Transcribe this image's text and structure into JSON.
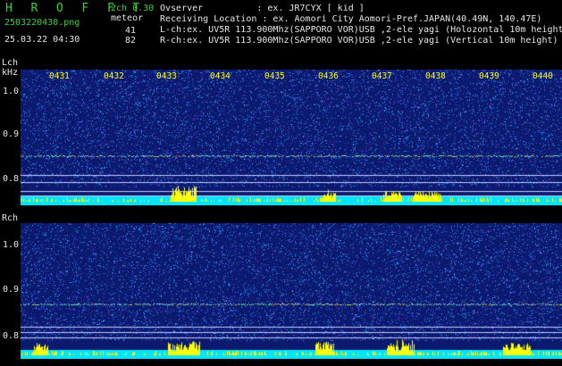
{
  "header": {
    "brand": "H R O F F T",
    "filename": "2503220430.png",
    "datetime": "25.03.22 04:30",
    "mode": "2ch 0.30",
    "meteor_label": "meteor",
    "meteor_lch": "41",
    "meteor_rch": "82",
    "info_lines": [
      "Ovserver          : ex. JR7CYX [ kid ]",
      "Receiving Location : ex. Aomori City Aomori-Pref.JAPAN(40.49N, 140.47E)",
      "L-ch:ex. UV5R 113.900Mhz(SAPPORO VOR)USB ,2-ele yagi (Holozontal 10m height",
      "R-ch:ex. UV5R 113.900Mhz(SAPPORO VOR)USB ,2-ele yagi (Vertical 10m height)"
    ]
  },
  "lch": {
    "channel_label": "Lch",
    "unit_label": "kHz",
    "y_ticks": [
      "1.0",
      "0.9",
      "0.8"
    ],
    "time_ticks": [
      "0431",
      "0432",
      "0433",
      "0434",
      "0435",
      "0436",
      "0437",
      "0438",
      "0439",
      "0440"
    ]
  },
  "rch": {
    "channel_label": "Rch",
    "y_ticks": [
      "1.0",
      "0.9",
      "0.8"
    ]
  },
  "colors": {
    "background": "#000000",
    "noise_bg": "#0a1a66",
    "activity_bar": "#ffff00",
    "baseline_bar": "#00e5ff",
    "label_green": "#39d139",
    "tick_yellow": "#ffff00"
  }
}
